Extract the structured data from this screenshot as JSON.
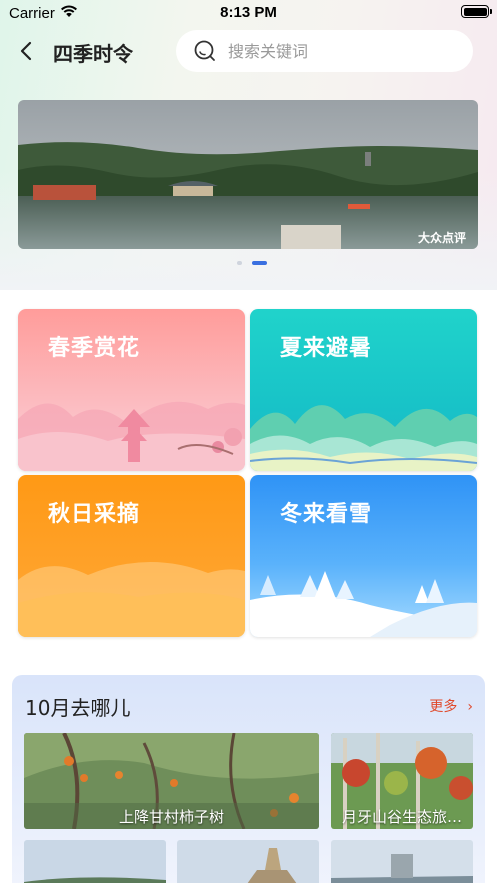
{
  "status_bar": {
    "carrier": "Carrier",
    "time": "8:13 PM"
  },
  "nav": {
    "title": "四季时令",
    "search_placeholder": "搜索关键词"
  },
  "banner": {
    "watermark": "大众点评",
    "page_count": 2,
    "active_page": 2
  },
  "seasons": [
    {
      "label": "春季赏花",
      "color_top": "#ff9c9a",
      "color_bottom": "#f9c6cf"
    },
    {
      "label": "夏来避暑",
      "color_top": "#1ccfc7",
      "color_bottom": "#1aa7c9"
    },
    {
      "label": "秋日采摘",
      "color_top": "#ff9a17",
      "color_bottom": "#ffae3d"
    },
    {
      "label": "冬来看雪",
      "color_top": "#2f93f6",
      "color_bottom": "#8ad0ff"
    }
  ],
  "monthly": {
    "title": "10月去哪儿",
    "more_label": "更多",
    "more_icon": "chevron-right-icon",
    "places": [
      {
        "name": "上降甘村柿子树"
      },
      {
        "name": "月牙山谷生态旅…"
      }
    ]
  },
  "accent_color": "#e04a2c"
}
